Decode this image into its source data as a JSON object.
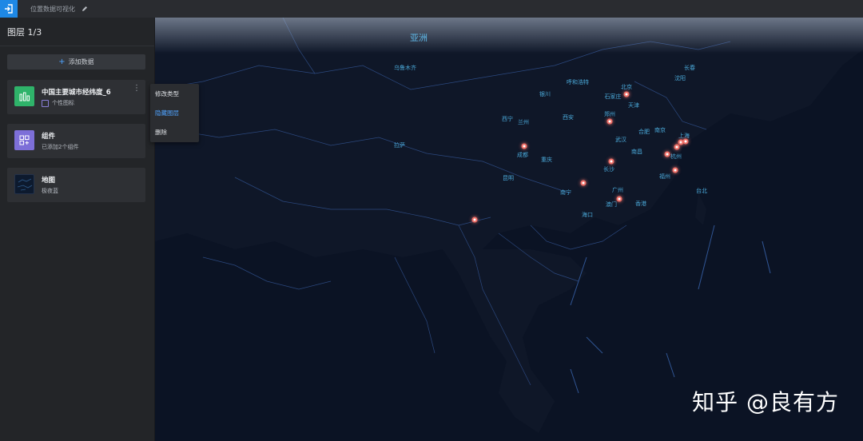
{
  "topbar": {
    "project_name": "位置数据可视化"
  },
  "sidebar": {
    "header": "图层 1/3",
    "add_data_label": "添加数据",
    "layers": [
      {
        "title": "中国主要城市经纬度_6",
        "subtitle": "个性图标",
        "thumb_color": "#2fb36a"
      },
      {
        "title": "组件",
        "subtitle": "已添加2个组件",
        "thumb_color": "#7d6fd8"
      },
      {
        "title": "地图",
        "subtitle": "极夜蓝",
        "thumb_color": "#0d1a2e"
      }
    ]
  },
  "context_menu": {
    "items": [
      {
        "label": "修改类型"
      },
      {
        "label": "隐藏图层"
      },
      {
        "label": "删除"
      }
    ]
  },
  "map": {
    "region_label": "亚洲",
    "cities": [
      {
        "name": "乌鲁木齐"
      },
      {
        "name": "长春"
      },
      {
        "name": "沈阳"
      },
      {
        "name": "呼和浩特"
      },
      {
        "name": "北京"
      },
      {
        "name": "银川"
      },
      {
        "name": "石家庄"
      },
      {
        "name": "天津"
      },
      {
        "name": "西宁"
      },
      {
        "name": "兰州"
      },
      {
        "name": "西安"
      },
      {
        "name": "郑州"
      },
      {
        "name": "合肥"
      },
      {
        "name": "南京"
      },
      {
        "name": "上海"
      },
      {
        "name": "武汉"
      },
      {
        "name": "拉萨"
      },
      {
        "name": "成都"
      },
      {
        "name": "重庆"
      },
      {
        "name": "南昌"
      },
      {
        "name": "杭州"
      },
      {
        "name": "长沙"
      },
      {
        "name": "福州"
      },
      {
        "name": "昆明"
      },
      {
        "name": "南宁"
      },
      {
        "name": "广州"
      },
      {
        "name": "台北"
      },
      {
        "name": "澳门"
      },
      {
        "name": "香港"
      },
      {
        "name": "海口"
      }
    ]
  },
  "watermark": "知乎 @良有方",
  "colors": {
    "accent": "#1e88e5",
    "marker": "#f07068",
    "map_bg": "#0b1324",
    "city_label": "#4aa8d8"
  }
}
